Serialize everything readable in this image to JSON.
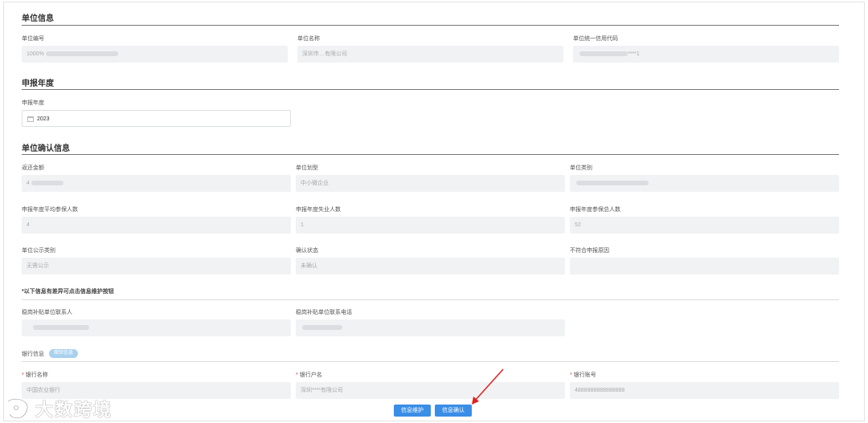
{
  "sections": {
    "unit_info": {
      "title": "单位信息",
      "fields": [
        {
          "label": "单位编号",
          "value": "1000%"
        },
        {
          "label": "单位名称",
          "value": "深圳市…有限公司"
        },
        {
          "label": "单位统一信用代码",
          "value": "****1"
        }
      ]
    },
    "declare_year": {
      "title": "申报年度",
      "field": {
        "label": "申报年度",
        "value": "2023"
      }
    },
    "confirm_info": {
      "title": "单位确认信息",
      "rows": [
        [
          {
            "label": "返还金额",
            "value": "4"
          },
          {
            "label": "单位划型",
            "value": "中小微企业"
          },
          {
            "label": "单位类别",
            "value": ""
          }
        ],
        [
          {
            "label": "申报年度平均参保人数",
            "value": "4"
          },
          {
            "label": "申报年度失业人数",
            "value": "1"
          },
          {
            "label": "申报年度参保总人数",
            "value": "52"
          }
        ],
        [
          {
            "label": "单位公示类别",
            "value": "无需公示"
          },
          {
            "label": "确认状态",
            "value": "未确认"
          },
          {
            "label": "不符合申报原因",
            "value": ""
          }
        ]
      ],
      "note": "*以下信息有差异可点击信息维护按钮",
      "contact_fields": [
        {
          "label": "稳岗补贴单位联系人",
          "value": ""
        },
        {
          "label": "稳岗补贴单位联系电话",
          "value": ""
        }
      ],
      "bank": {
        "title": "银行信息",
        "tag": "面验信息",
        "fields": [
          {
            "label": "银行名称",
            "value": "中国农业银行",
            "required": "*"
          },
          {
            "label": "银行户名",
            "value": "深圳****有限公司",
            "required": "*"
          },
          {
            "label": "银行账号",
            "value": "4888888888888888",
            "required": "*"
          }
        ]
      }
    }
  },
  "buttons": {
    "maintain": "信息维护",
    "confirm": "信息确认"
  },
  "watermark": {
    "text": "大数跨境"
  },
  "colors": {
    "primary": "#3a8ee6",
    "field_bg": "#f1f2f4",
    "required": "#e23b3b",
    "arrow": "#e02020"
  }
}
